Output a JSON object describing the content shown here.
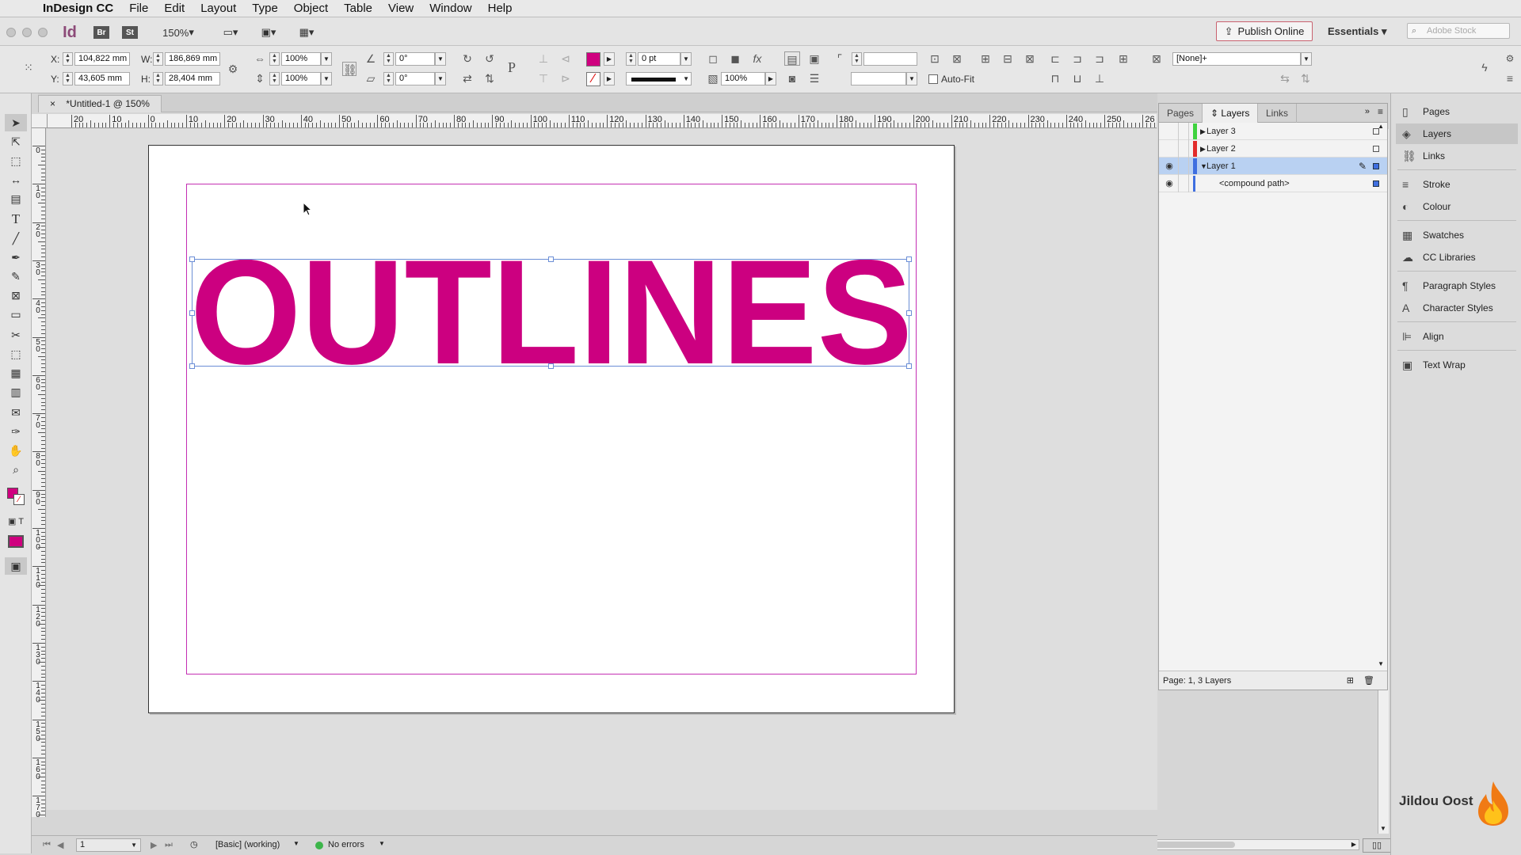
{
  "menubar": {
    "app_name": "InDesign CC",
    "items": [
      "File",
      "Edit",
      "Layout",
      "Type",
      "Object",
      "Table",
      "View",
      "Window",
      "Help"
    ]
  },
  "appbar": {
    "zoom": "150%",
    "publish_label": "Publish Online",
    "workspace": "Essentials",
    "search_placeholder": "Adobe Stock",
    "br": "Br",
    "st": "St"
  },
  "control": {
    "x_label": "X:",
    "x_value": "104,822 mm",
    "y_label": "Y:",
    "y_value": "43,605 mm",
    "w_label": "W:",
    "w_value": "186,869 mm",
    "h_label": "H:",
    "h_value": "28,404 mm",
    "scale_x": "100%",
    "scale_y": "100%",
    "rotate": "0°",
    "shear": "0°",
    "stroke_weight": "0 pt",
    "opacity": "100%",
    "auto_fit": "Auto-Fit",
    "object_style": "[None]+",
    "fill_color": "#cf007f"
  },
  "document": {
    "tab_title": "*Untitled-1 @ 150%",
    "outlined_text": "OUTLINES",
    "text_color": "#cc0080"
  },
  "rulers": {
    "h_labels": [
      "20",
      "10",
      "0",
      "10",
      "20",
      "30",
      "40",
      "50",
      "60",
      "70",
      "80",
      "90",
      "100",
      "110",
      "120",
      "130",
      "140",
      "150",
      "160",
      "170",
      "180",
      "190",
      "200",
      "210",
      "220",
      "230",
      "240",
      "250",
      "26"
    ],
    "v_labels": [
      "0",
      "1 0",
      "2 0",
      "3 0",
      "4 0",
      "5 0",
      "6 0",
      "7 0",
      "8 0",
      "9 0",
      "1 0 0",
      "1 1 0",
      "1 2 0",
      "1 3 0",
      "1 4 0",
      "1 5 0",
      "1 6 0",
      "1 7 0"
    ]
  },
  "status": {
    "page": "1",
    "preflight_profile": "[Basic] (working)",
    "errors": "No errors"
  },
  "layers_panel": {
    "tabs": [
      "Pages",
      "Layers",
      "Links"
    ],
    "active_tab": "Layers",
    "rows": [
      {
        "name": "Layer 3",
        "color": "#3ed23e",
        "visible": false,
        "selected": false
      },
      {
        "name": "Layer 2",
        "color": "#e22b2b",
        "visible": false,
        "selected": false
      },
      {
        "name": "Layer 1",
        "color": "#3f6fe0",
        "visible": true,
        "selected": true
      },
      {
        "name": "<compound path>",
        "color": "#3f6fe0",
        "visible": true,
        "selected": false
      }
    ],
    "footer": "Page: 1, 3 Layers"
  },
  "dock": {
    "items": [
      {
        "label": "Pages",
        "icon": "pages-icon"
      },
      {
        "label": "Layers",
        "icon": "layers-icon"
      },
      {
        "label": "Links",
        "icon": "links-icon"
      },
      {
        "label": "Stroke",
        "icon": "stroke-icon"
      },
      {
        "label": "Colour",
        "icon": "colour-icon"
      },
      {
        "label": "Swatches",
        "icon": "swatches-icon"
      },
      {
        "label": "CC Libraries",
        "icon": "cc-libraries-icon"
      },
      {
        "label": "Paragraph Styles",
        "icon": "paragraph-styles-icon"
      },
      {
        "label": "Character Styles",
        "icon": "character-styles-icon"
      },
      {
        "label": "Align",
        "icon": "align-icon"
      },
      {
        "label": "Text Wrap",
        "icon": "text-wrap-icon"
      }
    ],
    "selected": "Layers"
  },
  "watermark": "Jildou Oost"
}
